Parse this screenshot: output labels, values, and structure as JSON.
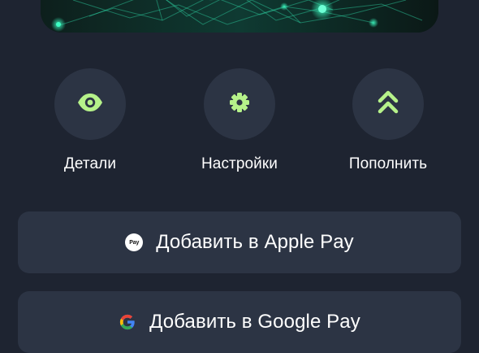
{
  "card": {
    "decoration": "network-pattern",
    "accent_color": "#27d3a4"
  },
  "actions": [
    {
      "id": "details",
      "label": "Детали",
      "icon": "eye-icon"
    },
    {
      "id": "settings",
      "label": "Настройки",
      "icon": "gear-icon"
    },
    {
      "id": "topup",
      "label": "Пополнить",
      "icon": "double-chevron-up-icon"
    }
  ],
  "apple_pay": {
    "label": "Добавить в Apple Pay",
    "icon": "apple-pay-icon",
    "badge_text": "Pay"
  },
  "google_pay": {
    "label": "Добавить в Google Pay",
    "icon": "google-g-icon"
  },
  "colors": {
    "background": "#1e2431",
    "surface": "#2c3444",
    "icon_accent": "#b6f28a"
  }
}
